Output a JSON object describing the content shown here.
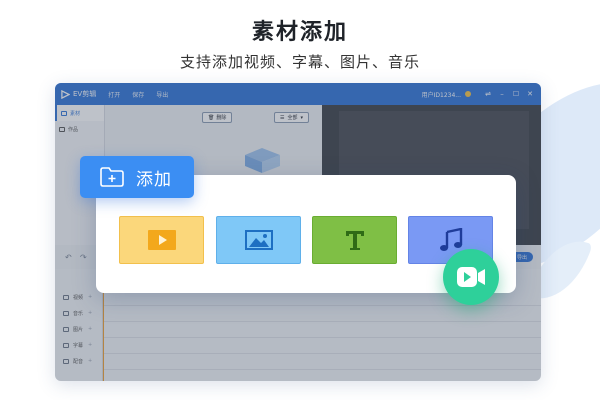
{
  "hero": {
    "title": "素材添加",
    "subtitle": "支持添加视频、字幕、图片、音乐"
  },
  "app": {
    "logo_text": "EV剪辑",
    "menu": [
      "打开",
      "保存",
      "导出"
    ],
    "user_id": "用户ID1234...",
    "window_controls": [
      "⇌",
      "–",
      "☐",
      "✕"
    ],
    "side_nav": [
      {
        "label": "素材",
        "icon": "folder-icon",
        "active": true
      },
      {
        "label": "作品",
        "icon": "film-icon",
        "active": false
      }
    ],
    "library": {
      "delete_label": "删除",
      "sort_label": "全部"
    },
    "export_label": "导出",
    "tracks": [
      {
        "label": "视频",
        "icon": "video-track-icon"
      },
      {
        "label": "音乐",
        "icon": "music-track-icon"
      },
      {
        "label": "图片",
        "icon": "image-track-icon"
      },
      {
        "label": "字幕",
        "icon": "subtitle-track-icon"
      },
      {
        "label": "配音",
        "icon": "mic-track-icon"
      }
    ]
  },
  "add_panel": {
    "add_label": "添加",
    "tiles": [
      {
        "type": "video",
        "icon": "play-icon",
        "color": "#fbd77b"
      },
      {
        "type": "image",
        "icon": "image-icon",
        "color": "#7fc8f7"
      },
      {
        "type": "text",
        "icon": "text-icon",
        "color": "#7fbf45"
      },
      {
        "type": "music",
        "icon": "music-note-icon",
        "color": "#7a99f4"
      }
    ]
  },
  "colors": {
    "brand_blue": "#2e74d8",
    "add_button": "#3b8ef3",
    "fab_green": "#2ed09a"
  }
}
